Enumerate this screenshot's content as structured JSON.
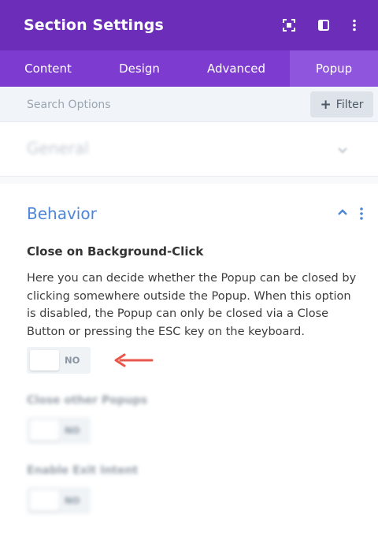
{
  "header": {
    "title": "Section Settings",
    "icons": [
      "focus-icon",
      "split-view-icon",
      "more-vertical-icon"
    ],
    "bg_color": "#6c2eb9"
  },
  "tabs": [
    {
      "label": "Content",
      "active": false
    },
    {
      "label": "Design",
      "active": false
    },
    {
      "label": "Advanced",
      "active": false
    },
    {
      "label": "Popup",
      "active": true
    }
  ],
  "search": {
    "placeholder": "Search Options",
    "filter_label": "Filter"
  },
  "sections": {
    "general": {
      "label": "General",
      "collapsed": true
    },
    "behavior": {
      "label": "Behavior",
      "collapsed": false
    }
  },
  "options": [
    {
      "title": "Close on Background-Click",
      "description": "Here you can decide whether the Popup can be closed by clicking somewhere outside the Popup. When this option is disabled, the Popup can only be closed via a Close Button or pressing the ESC key on the keyboard.",
      "value": "NO"
    },
    {
      "title": "Close other Popups",
      "value": "NO"
    },
    {
      "title": "Enable Exit Intent",
      "value": "NO"
    }
  ],
  "colors": {
    "accent": "#4f86d8",
    "tab_bar": "#7d3bcf",
    "active_tab": "#8f55dd",
    "arrow": "#e8574a"
  }
}
